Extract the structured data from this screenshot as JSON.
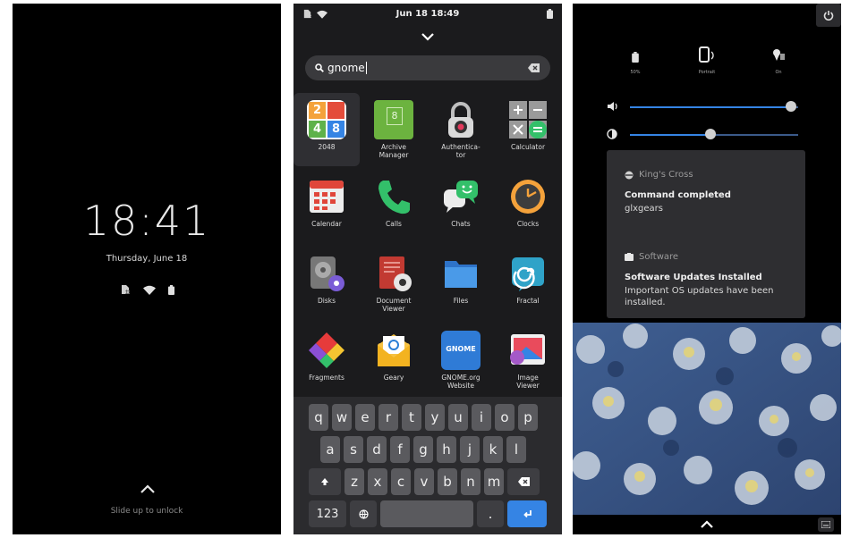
{
  "lock": {
    "time": "18:41",
    "date": "Thursday, June 18",
    "hint": "Slide up to unlock"
  },
  "launcher": {
    "status_time": "Jun 18  18:49",
    "search_value": "gnome",
    "apps": [
      {
        "label": "2048"
      },
      {
        "label": "Archive\nManager"
      },
      {
        "label": "Authentica-\ntor"
      },
      {
        "label": "Calculator"
      },
      {
        "label": "Calendar"
      },
      {
        "label": "Calls"
      },
      {
        "label": "Chats"
      },
      {
        "label": "Clocks"
      },
      {
        "label": "Disks"
      },
      {
        "label": "Document\nViewer"
      },
      {
        "label": "Files"
      },
      {
        "label": "Fractal"
      },
      {
        "label": "Fragments"
      },
      {
        "label": "Geary"
      },
      {
        "label": "GNOME.org\nWebsite"
      },
      {
        "label": "Image\nViewer"
      }
    ],
    "tile_2048": [
      "2",
      "4",
      "8"
    ],
    "archive_digit": "8",
    "gnome_tile_text": "GNOME",
    "keyboard": {
      "row1": [
        "q",
        "w",
        "e",
        "r",
        "t",
        "y",
        "u",
        "i",
        "o",
        "p"
      ],
      "row2": [
        "a",
        "s",
        "d",
        "f",
        "g",
        "h",
        "j",
        "k",
        "l"
      ],
      "row3": [
        "z",
        "x",
        "c",
        "v",
        "b",
        "n",
        "m"
      ],
      "numbers_label": "123",
      "period": "."
    }
  },
  "quick_settings": {
    "toggles": [
      {
        "caption": "50%",
        "icon": "battery-icon"
      },
      {
        "caption": "Portrait",
        "icon": "rotation-icon"
      },
      {
        "caption": "On",
        "icon": "location-icon"
      }
    ],
    "volume_level": 0.96,
    "brightness_level": 0.48,
    "notifications": [
      {
        "app": "King's Cross",
        "title": "Command completed",
        "body": "glxgears"
      },
      {
        "app": "Software",
        "title": "Software Updates Installed",
        "body": "Important OS updates have been installed."
      }
    ]
  },
  "colors": {
    "accent": "#3584e4",
    "panel_bg": "#000000",
    "launcher_bg": "#1b1b1d"
  }
}
